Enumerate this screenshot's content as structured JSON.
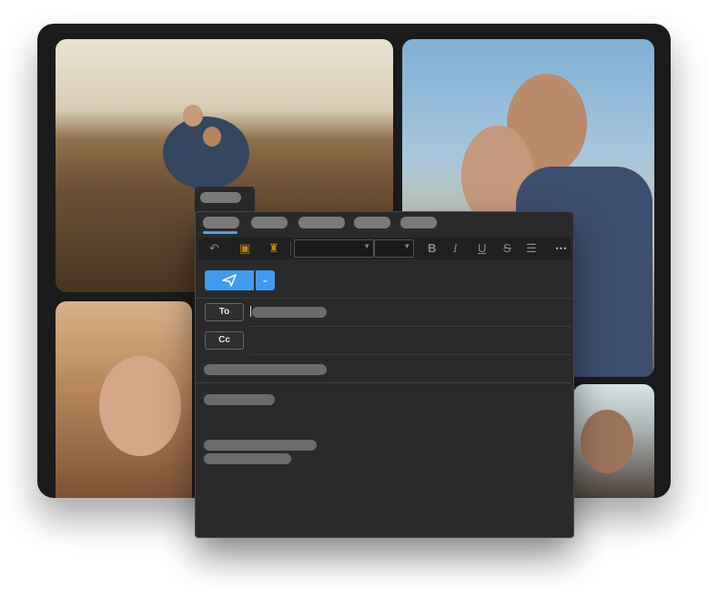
{
  "compose": {
    "to_label": "To",
    "cc_label": "Cc"
  },
  "icons": [
    "undo-icon",
    "paste-icon",
    "format-painter-icon",
    "bold-icon",
    "italic-icon",
    "underline-icon",
    "strikethrough-icon",
    "list-icon",
    "more-icon",
    "send-icon",
    "chevron-down-icon"
  ],
  "colors": {
    "accent": "#3f9bf2",
    "window_bg": "#2a2a2a",
    "placeholder": "#6b6b6b"
  }
}
